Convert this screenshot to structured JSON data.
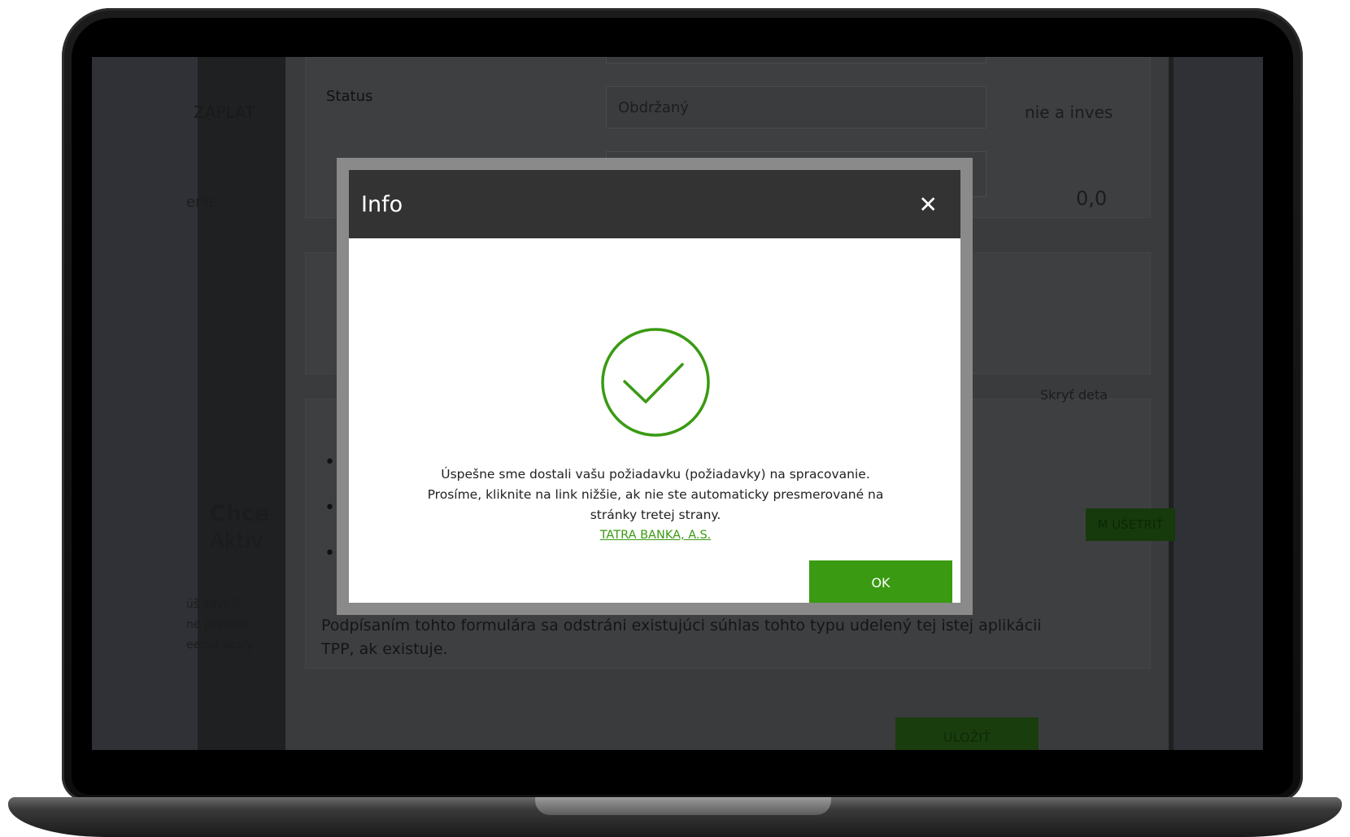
{
  "background": {
    "status_label": "Status",
    "status_value": "Obdržaný",
    "left_heading": "ZAPLAT",
    "right_heading": "nie a inves",
    "left_snippet": "enie",
    "right_amount": "0,0",
    "right_link": "Skryť deta",
    "left_promo_1": "Chce",
    "left_promo_2": "Aktiv",
    "left_small_1": "úš Koveži",
    "left_small_2": "ne prihláse",
    "left_small_3": "eerne skary",
    "right_button": "M UŠETRIŤ",
    "footer_text": "Podpísaním tohto formulára sa odstráni existujúci súhlas tohto typu udelený tej istej aplikácii TPP, ak existuje.",
    "save_button": "ULOŽIŤ"
  },
  "modal": {
    "title": "Info",
    "close_icon": "close-icon",
    "success_icon": "check-circle-icon",
    "message_line1": "Úspešne sme dostali vašu požiadavku (požiadavky) na spracovanie.",
    "message_line2": "Prosíme, kliknite na link nižšie, ak nie ste automaticky presmerované na",
    "message_line3": "stránky tretej strany.",
    "link_text": "TATRA BANKA, A.S.",
    "ok_label": "OK",
    "accent_color": "#3a9a12"
  }
}
